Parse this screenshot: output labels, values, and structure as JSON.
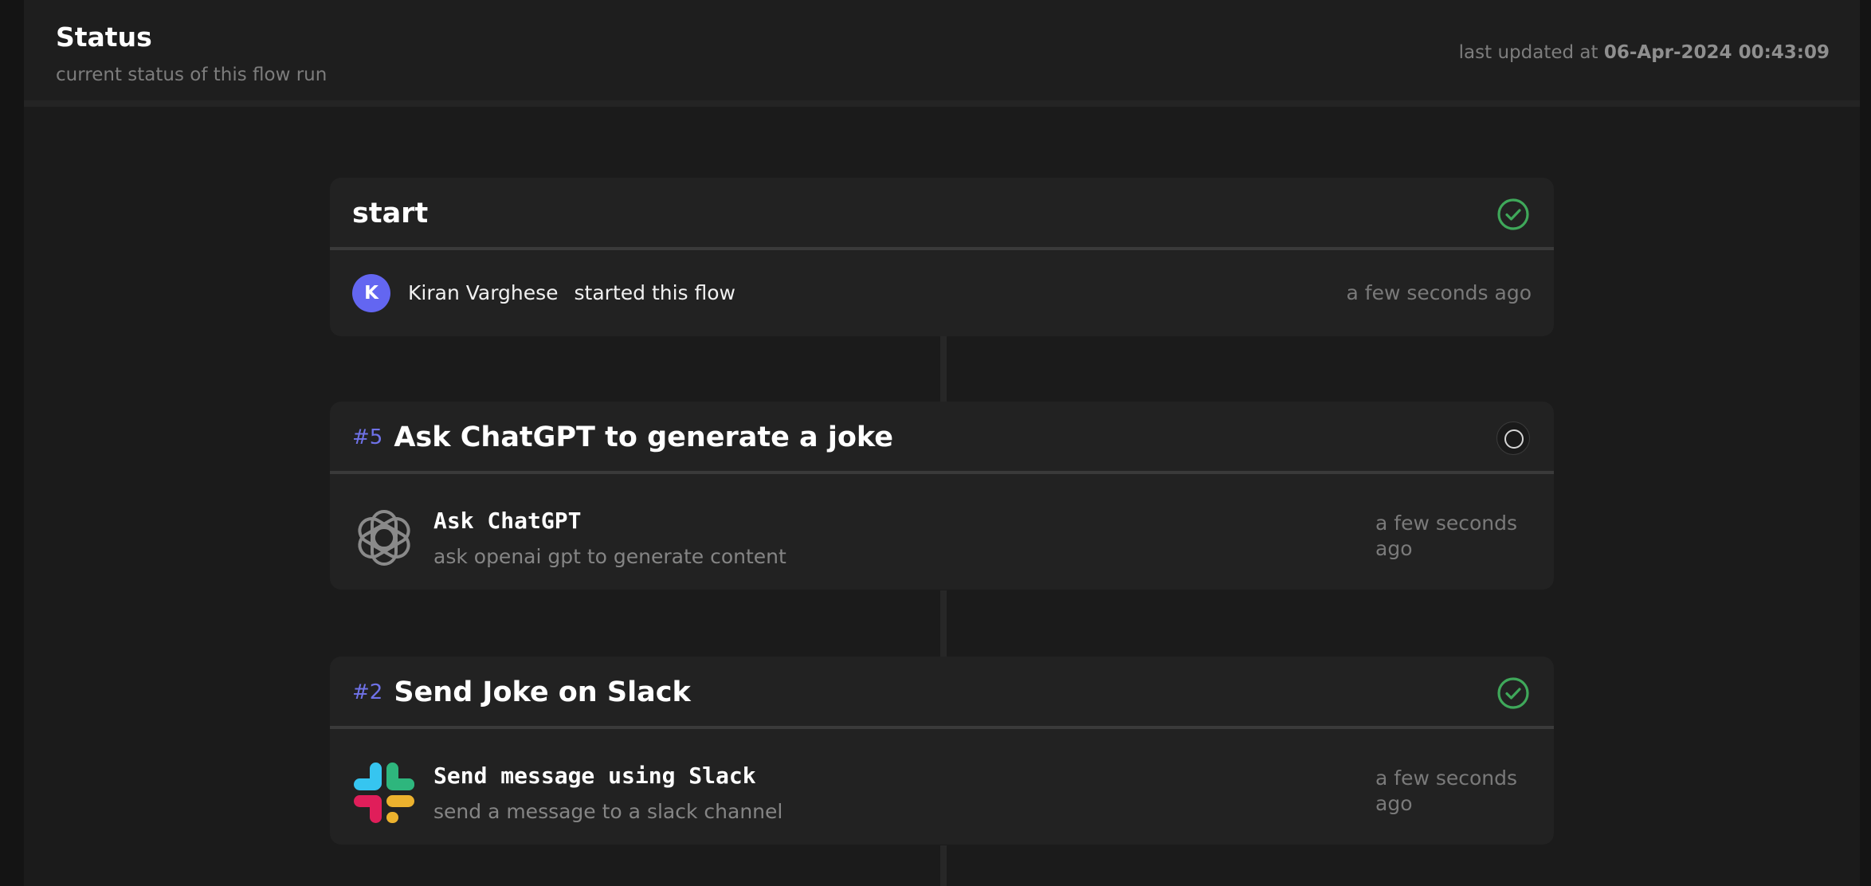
{
  "header": {
    "title": "Status",
    "subtitle": "current status of this flow run",
    "updated_prefix": "last updated at",
    "updated_value": "06-Apr-2024 00:43:09"
  },
  "start": {
    "title": "start",
    "status_icon": "check-circle-icon",
    "avatar_initial": "K",
    "user_name": "Kiran Varghese",
    "action": "started this flow",
    "time": "a few seconds ago"
  },
  "steps": [
    {
      "number": "#5",
      "title": "Ask ChatGPT to generate a joke",
      "status": "pending",
      "status_icon": "pending-circle-icon",
      "task": {
        "icon": "openai-logo-icon",
        "name": "Ask ChatGPT",
        "description": "ask openai gpt to generate content",
        "time": "a few seconds ago"
      }
    },
    {
      "number": "#2",
      "title": "Send Joke on Slack",
      "status": "done",
      "status_icon": "check-circle-icon",
      "task": {
        "icon": "slack-logo-icon",
        "name": "Send message using Slack",
        "description": "send a message to a slack channel",
        "time": "a few seconds ago"
      }
    }
  ],
  "colors": {
    "background": "#1b1b1b",
    "card": "#222222",
    "accent": "#6f72e8",
    "success": "#3fa85a",
    "avatar": "#6366f1"
  }
}
